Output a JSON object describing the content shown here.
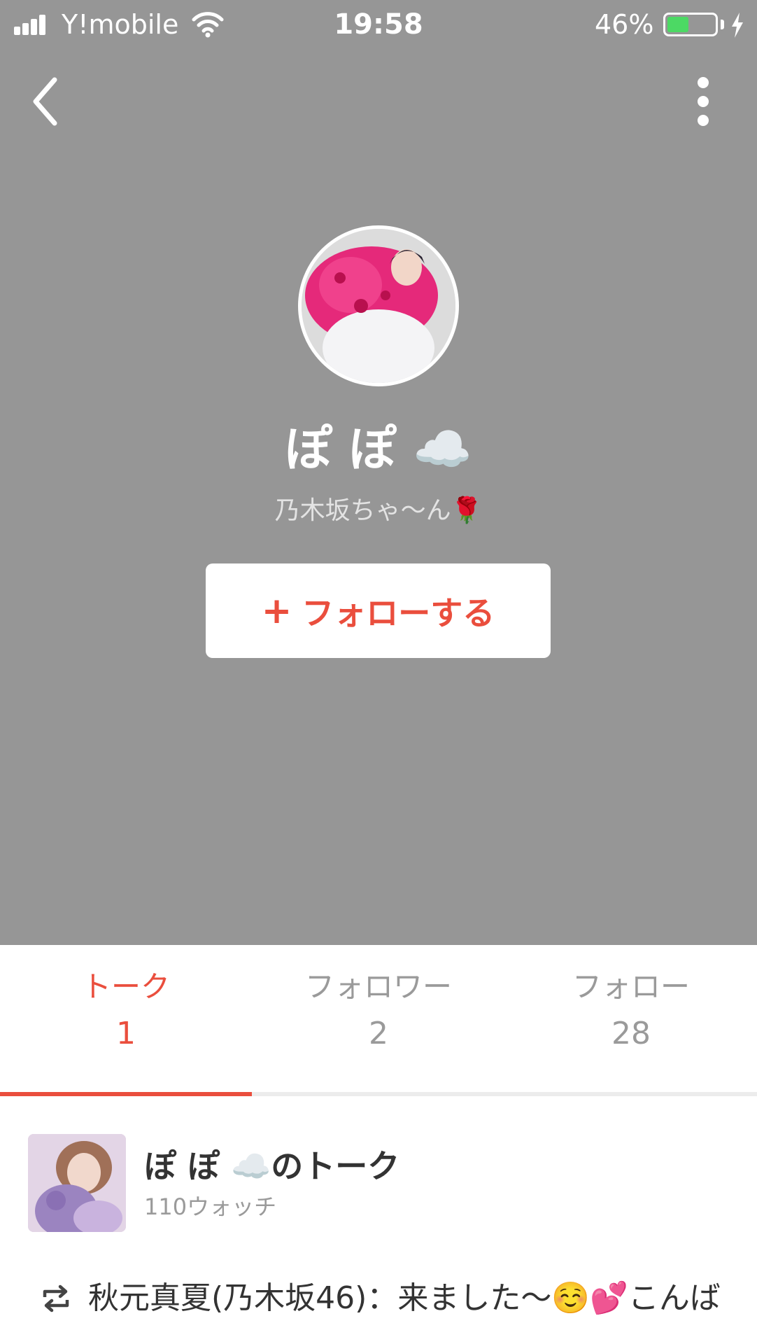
{
  "status_bar": {
    "carrier": "Y!mobile",
    "time": "19:58",
    "battery_percent": "46%",
    "battery_level": 0.46,
    "battery_fill_color": "#4cd964"
  },
  "profile": {
    "name": "ぽ ぽ ☁️",
    "bio": "乃木坂ちゃ〜ん🌹",
    "follow_button_label": "フォローする",
    "follow_button_plus": "+"
  },
  "icons": {
    "back": "chevron-left-icon",
    "more": "more-vertical-icon",
    "repost": "repost-icon"
  },
  "tabs": [
    {
      "label": "トーク",
      "count": "1",
      "active": true
    },
    {
      "label": "フォロワー",
      "count": "2",
      "active": false
    },
    {
      "label": "フォロー",
      "count": "28",
      "active": false
    }
  ],
  "talk": {
    "title": "ぽ ぽ ☁️のトーク",
    "watch_count": "110ウォッチ",
    "latest": "秋元真夏(乃木坂46)：来ました〜☺️💕こんば"
  },
  "colors": {
    "header_bg": "#969696",
    "accent": "#ea4e3d",
    "inactive_tab": "#9a9a9a"
  }
}
